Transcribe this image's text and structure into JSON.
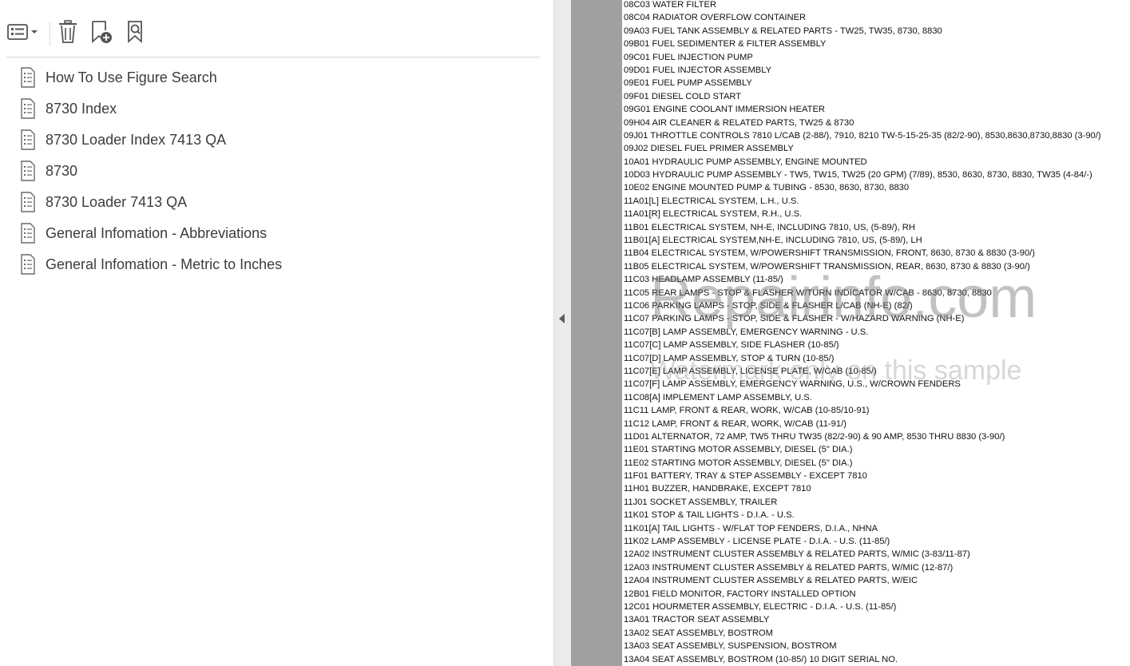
{
  "toolbar": {
    "options_icon": "list-options-icon",
    "delete_icon": "trash-icon",
    "new_bookmark_icon": "bookmark-add-icon",
    "find_bookmark_icon": "bookmark-search-icon"
  },
  "bookmarks": [
    {
      "label": "How To Use Figure Search"
    },
    {
      "label": "8730 Index"
    },
    {
      "label": "8730 Loader Index 7413 QA"
    },
    {
      "label": "8730"
    },
    {
      "label": "8730 Loader 7413 QA"
    },
    {
      "label": "General Infomation - Abbreviations"
    },
    {
      "label": "General Infomation - Metric to Inches"
    }
  ],
  "document": {
    "lines": [
      "08C03 WATER FILTER",
      "08C04 RADIATOR OVERFLOW CONTAINER",
      "09A03 FUEL TANK ASSEMBLY & RELATED PARTS - TW25, TW35, 8730, 8830",
      "09B01 FUEL SEDIMENTER & FILTER ASSEMBLY",
      "09C01 FUEL INJECTION PUMP",
      "09D01 FUEL INJECTOR ASSEMBLY",
      "09E01 FUEL PUMP ASSEMBLY",
      "09F01 DIESEL COLD START",
      "09G01 ENGINE COOLANT IMMERSION HEATER",
      "09H04 AIR CLEANER & RELATED PARTS, TW25 & 8730",
      "09J01 THROTTLE CONTROLS 7810 L/CAB (2-88/), 7910, 8210 TW-5-15-25-35 (82/2-90), 8530,8630,8730,8830 (3-90/)",
      "09J02 DIESEL FUEL PRIMER ASSEMBLY",
      "10A01 HYDRAULIC PUMP ASSEMBLY, ENGINE MOUNTED",
      "10D03 HYDRAULIC PUMP ASSEMBLY - TW5, TW15, TW25 (20 GPM) (7/89), 8530, 8630, 8730, 8830, TW35 (4-84/-)",
      "10E02 ENGINE MOUNTED PUMP & TUBING - 8530, 8630, 8730, 8830",
      "11A01[L] ELECTRICAL SYSTEM, L.H., U.S.",
      "11A01[R] ELECTRICAL SYSTEM, R.H., U.S.",
      "11B01 ELECTRICAL SYSTEM, NH-E, INCLUDING 7810, US, (5-89/), RH",
      "11B01[A] ELECTRICAL SYSTEM,NH-E, INCLUDING 7810, US, (5-89/), LH",
      "11B04 ELECTRICAL SYSTEM, W/POWERSHIFT TRANSMISSION, FRONT,  8630, 8730 & 8830 (3-90/)",
      "11B05 ELECTRICAL SYSTEM, W/POWERSHIFT TRANSMISSION, REAR, 8630, 8730 & 8830 (3-90/)",
      "11C03 HEADLAMP ASSEMBLY (11-85/)",
      "11C05 REAR LAMPS - STOP & FLASHER W/TURN INDICATOR W/CAB - 8630, 8730, 8830",
      "11C06 PARKING LAMPS - STOP, SIDE & FLASHER L/CAB (NH-E) (82/)",
      "11C07 PARKING LAMPS - STOP, SIDE & FLASHER - W/HAZARD WARNING (NH-E)",
      "11C07[B] LAMP ASSEMBLY, EMERGENCY WARNING - U.S.",
      "11C07[C] LAMP ASSEMBLY, SIDE FLASHER (10-85/)",
      "11C07[D] LAMP ASSEMBLY, STOP & TURN (10-85/)",
      "11C07[E] LAMP ASSEMBLY, LICENSE PLATE, W/CAB (10-85/)",
      "11C07[F] LAMP ASSEMBLY, EMERGENCY WARNING, U.S., W/CROWN FENDERS",
      "11C08[A] IMPLEMENT LAMP ASSEMBLY, U.S.",
      "11C11 LAMP, FRONT & REAR, WORK, W/CAB (10-85/10-91)",
      "11C12 LAMP, FRONT & REAR, WORK, W/CAB (11-91/)",
      "11D01 ALTERNATOR, 72 AMP, TW5 THRU TW35 (82/2-90) & 90 AMP, 8530 THRU 8830 (3-90/)",
      "11E01 STARTING MOTOR ASSEMBLY, DIESEL (5\" DIA.)",
      "11E02 STARTING MOTOR ASSEMBLY, DIESEL (5\" DIA.)",
      "11F01 BATTERY, TRAY & STEP ASSEMBLY - EXCEPT 7810",
      "11H01 BUZZER, HANDBRAKE, EXCEPT 7810",
      "11J01 SOCKET ASSEMBLY, TRAILER",
      "11K01 STOP & TAIL LIGHTS - D.I.A. - U.S.",
      "11K01[A] TAIL LIGHTS - W/FLAT TOP FENDERS, D.I.A., NHNA",
      "11K02 LAMP ASSEMBLY - LICENSE PLATE - D.I.A. - U.S. (11-85/)",
      "12A02 INSTRUMENT CLUSTER ASSEMBLY & RELATED PARTS, W/MIC (3-83/11-87)",
      "12A03 INSTRUMENT CLUSTER ASSEMBLY & RELATED PARTS, W/MIC (12-87/)",
      "12A04 INSTRUMENT CLUSTER ASSEMBLY & RELATED PARTS, W/EIC",
      "12B01 FIELD MONITOR, FACTORY INSTALLED OPTION",
      "12C01 HOURMETER ASSEMBLY, ELECTRIC - D.I.A. - U.S. (11-85/)",
      "13A01 TRACTOR SEAT ASSEMBLY",
      "13A02 SEAT ASSEMBLY, BOSTROM",
      "13A03 SEAT ASSEMBLY, SUSPENSION, BOSTROM",
      "13A04 SEAT ASSEMBLY, BOSTROM (10-85/) 10 DIGIT SERIAL NO."
    ],
    "watermark_main": "Repairinfo.com",
    "watermark_sub": "Watermark only on this sample"
  }
}
